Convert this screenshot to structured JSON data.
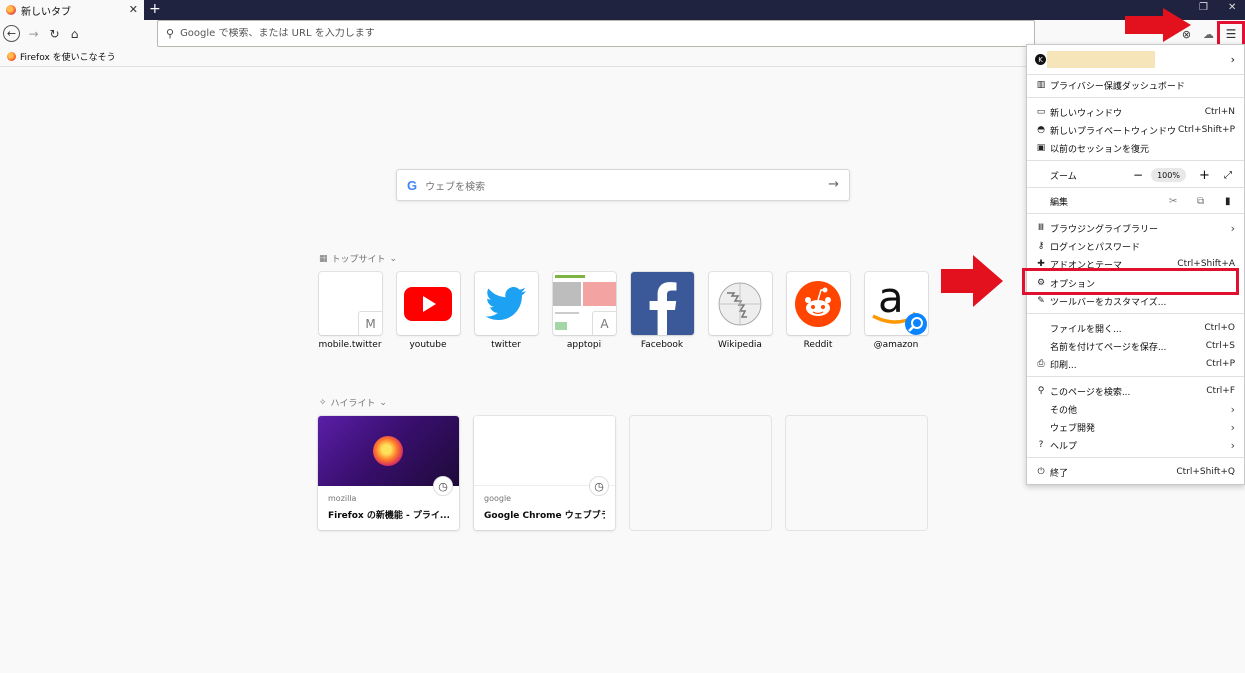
{
  "tab": {
    "title": "新しいタブ",
    "close": "✕"
  },
  "window": {
    "new_tab": "+",
    "restore": "❐",
    "close": "✕"
  },
  "nav": {
    "back": "←",
    "forward": "→",
    "reload": "↻",
    "home": "⌂"
  },
  "urlbar": {
    "placeholder": "Google で検索、または URL を入力します"
  },
  "toolbar": {
    "menu": "☰"
  },
  "bookmarks": [
    {
      "label": "Firefox を使いこなそう"
    }
  ],
  "newtab": {
    "search_placeholder": "ウェブを検索",
    "search_logo": "G",
    "top_sites_title": "トップサイト",
    "top_sites": [
      {
        "label": "mobile.twitter",
        "badge": "M"
      },
      {
        "label": "youtube"
      },
      {
        "label": "twitter"
      },
      {
        "label": "apptopi",
        "badge": "A"
      },
      {
        "label": "Facebook"
      },
      {
        "label": "Wikipedia"
      },
      {
        "label": "Reddit"
      },
      {
        "label": "@amazon"
      }
    ],
    "highlights_title": "ハイライト",
    "highlights": [
      {
        "source": "mozilla",
        "title": "Firefox の新機能 - プライ..."
      },
      {
        "source": "google",
        "title": "Google Chrome ウェブブラ..."
      }
    ]
  },
  "menu": {
    "items": [
      {
        "label": "プライバシー保護ダッシュボード"
      },
      {
        "label": "新しいウィンドウ",
        "shortcut": "Ctrl+N"
      },
      {
        "label": "新しいプライベートウィンドウ",
        "shortcut": "Ctrl+Shift+P"
      },
      {
        "label": "以前のセッションを復元"
      },
      {
        "label": "ズーム",
        "zoom_value": "100%"
      },
      {
        "label": "編集"
      },
      {
        "label": "ブラウジングライブラリー"
      },
      {
        "label": "ログインとパスワード"
      },
      {
        "label": "アドオンとテーマ",
        "shortcut": "Ctrl+Shift+A"
      },
      {
        "label": "オプション"
      },
      {
        "label": "ツールバーをカスタマイズ..."
      },
      {
        "label": "ファイルを開く...",
        "shortcut": "Ctrl+O"
      },
      {
        "label": "名前を付けてページを保存...",
        "shortcut": "Ctrl+S"
      },
      {
        "label": "印刷...",
        "shortcut": "Ctrl+P"
      },
      {
        "label": "このページを検索...",
        "shortcut": "Ctrl+F"
      },
      {
        "label": "その他"
      },
      {
        "label": "ウェブ開発"
      },
      {
        "label": "ヘルプ"
      },
      {
        "label": "終了",
        "shortcut": "Ctrl+Shift+Q"
      }
    ]
  },
  "colors": {
    "annotation_red": "#e3101e",
    "tabbar_bg": "#202340",
    "reddit_orange": "#ff4500",
    "facebook_blue": "#3b5998"
  }
}
